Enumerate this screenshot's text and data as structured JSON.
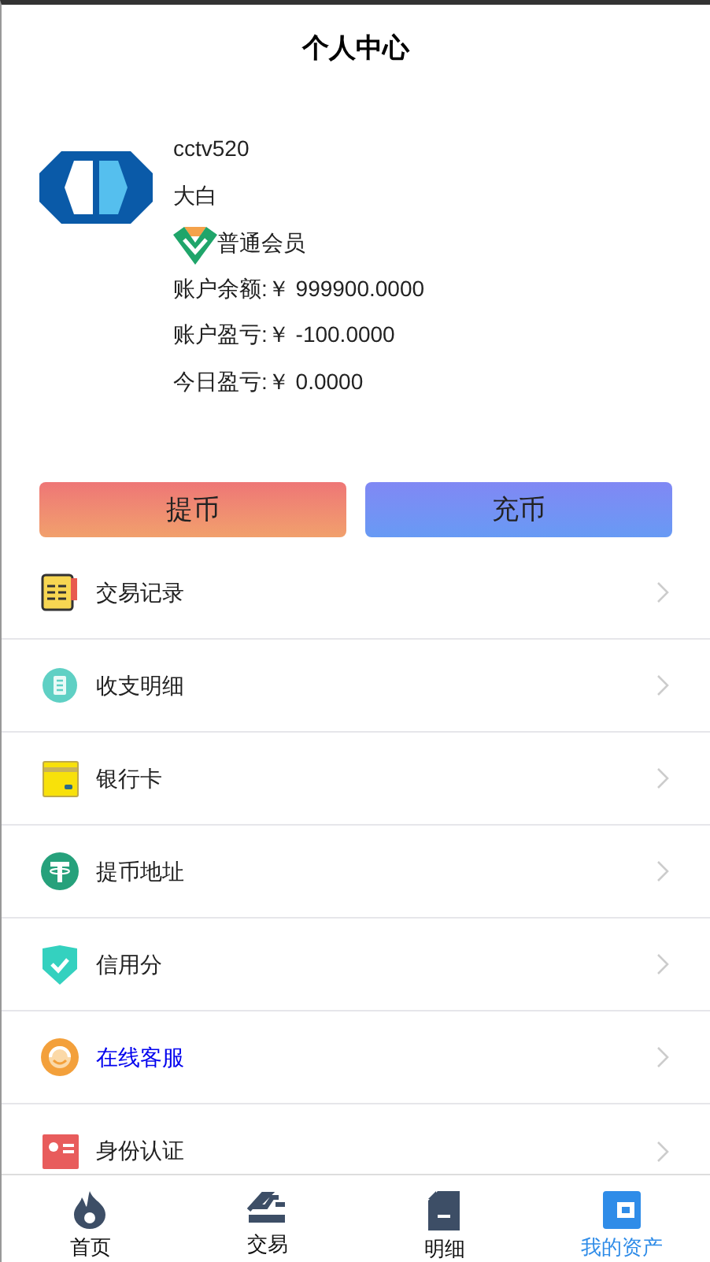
{
  "header": {
    "title": "个人中心"
  },
  "profile": {
    "username": "cctv520",
    "nickname": "大白",
    "member_level": "普通会员",
    "balance": "账户余额:￥ 999900.0000",
    "profit_loss": "账户盈亏:￥ -100.0000",
    "today_profit_loss": "今日盈亏:￥ 0.0000"
  },
  "actions": [
    {
      "label": "提币",
      "kind": "withdraw"
    },
    {
      "label": "充币",
      "kind": "deposit"
    }
  ],
  "menu": [
    {
      "label": "交易记录",
      "kind": "records",
      "highlighted": false
    },
    {
      "label": "收支明细",
      "kind": "details",
      "highlighted": false
    },
    {
      "label": "银行卡",
      "kind": "card",
      "highlighted": false
    },
    {
      "label": "提币地址",
      "kind": "address",
      "highlighted": false
    },
    {
      "label": "信用分",
      "kind": "credit",
      "highlighted": false
    },
    {
      "label": "在线客服",
      "kind": "service",
      "highlighted": true
    },
    {
      "label": "身份认证",
      "kind": "identity",
      "highlighted": false
    }
  ],
  "tab_bar": [
    {
      "label": "首页",
      "kind": "home",
      "selected": false
    },
    {
      "label": "交易",
      "kind": "trade",
      "selected": false
    },
    {
      "label": "明细",
      "kind": "details",
      "selected": false
    },
    {
      "label": "我的资产",
      "kind": "assets",
      "selected": true
    }
  ]
}
